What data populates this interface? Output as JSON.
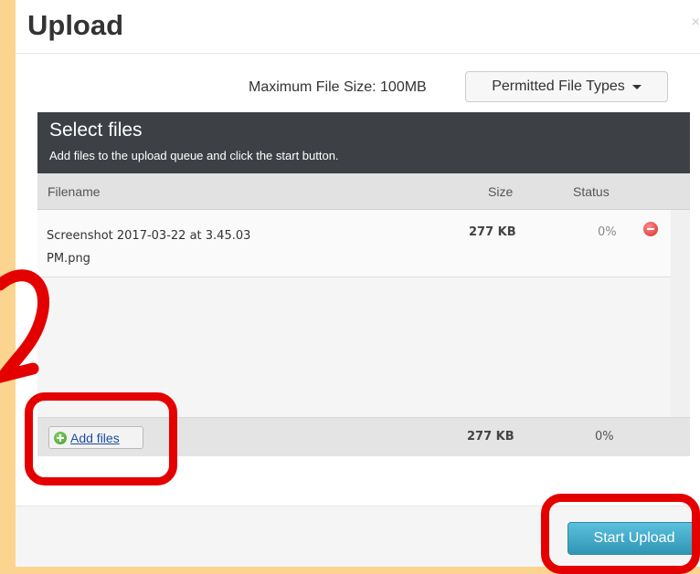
{
  "dialog": {
    "title": "Upload",
    "close_label": "×"
  },
  "limits": {
    "max_size_label": "Maximum File Size: 100MB",
    "types_button": "Permitted File Types"
  },
  "uploader": {
    "title": "Select files",
    "subtitle": "Add files to the upload queue and click the start button.",
    "columns": {
      "filename": "Filename",
      "size": "Size",
      "status": "Status"
    },
    "files": [
      {
        "name_line1": "Screenshot 2017-03-22 at 3.45.03",
        "name_line2": "PM.png",
        "size": "277 KB",
        "status": "0%"
      }
    ],
    "footer": {
      "add_files": "Add files",
      "total_size": "277 KB",
      "total_status": "0%"
    }
  },
  "actions": {
    "start_upload": "Start Upload"
  },
  "colors": {
    "highlight": "#e50000",
    "primary": "#49afcd",
    "header_dark": "#3d4145"
  }
}
